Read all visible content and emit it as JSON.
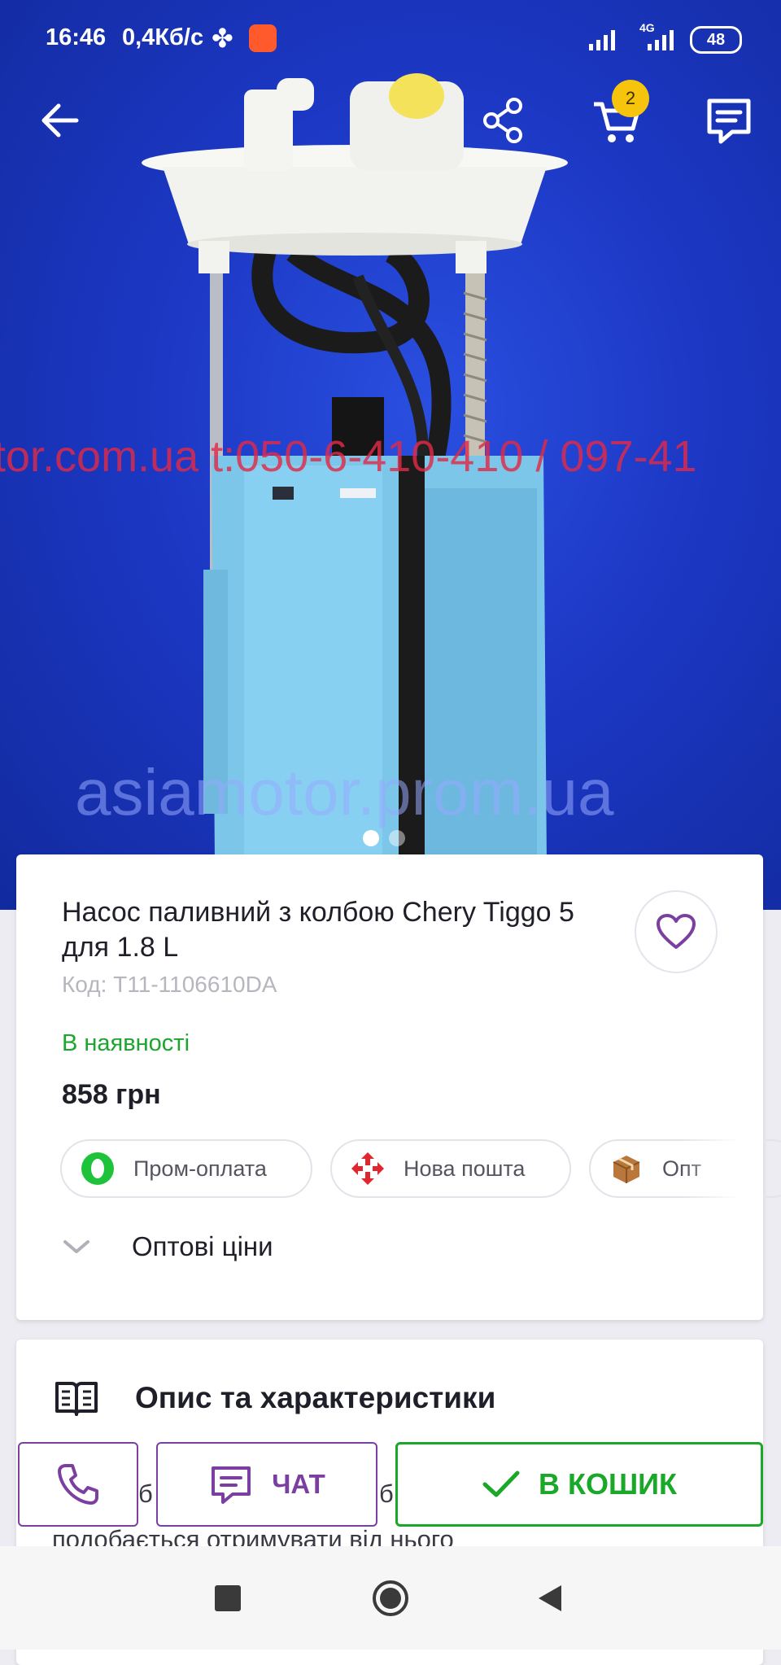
{
  "status_bar": {
    "time": "16:46",
    "speed": "0,4Кб/с",
    "network": "4G",
    "battery": "48"
  },
  "top_bar": {
    "cart_count": "2"
  },
  "gallery": {
    "watermark_contacts": "tor.com.ua  t:050-6-410-410 / 097-41",
    "watermark_site": "asiamotor.prom.ua",
    "pages": 2,
    "active_page": 1
  },
  "product": {
    "title": "Насос паливний з колбою Chery Tiggo 5 для 1.8 L",
    "sku": "Код: T11-1106610DA",
    "availability": "В наявності",
    "price": "858 грн",
    "chips": {
      "payment": "Пром-оплата",
      "delivery": "Нова пошта",
      "third": "Опт"
    },
    "wholesale_label": "Оптові ціни"
  },
  "description": {
    "title": "Опис та характеристики",
    "fragment_left": "б",
    "fragment_right": "б",
    "text_partial": "подобається отримувати від нього"
  },
  "actions": {
    "chat_label": "ЧАТ",
    "cart_label": "В КОШИК"
  },
  "colors": {
    "accent_purple": "#7a3fa0",
    "success_green": "#19a827",
    "badge_yellow": "#f6c40d",
    "hero_blue": "#1c38c4"
  }
}
